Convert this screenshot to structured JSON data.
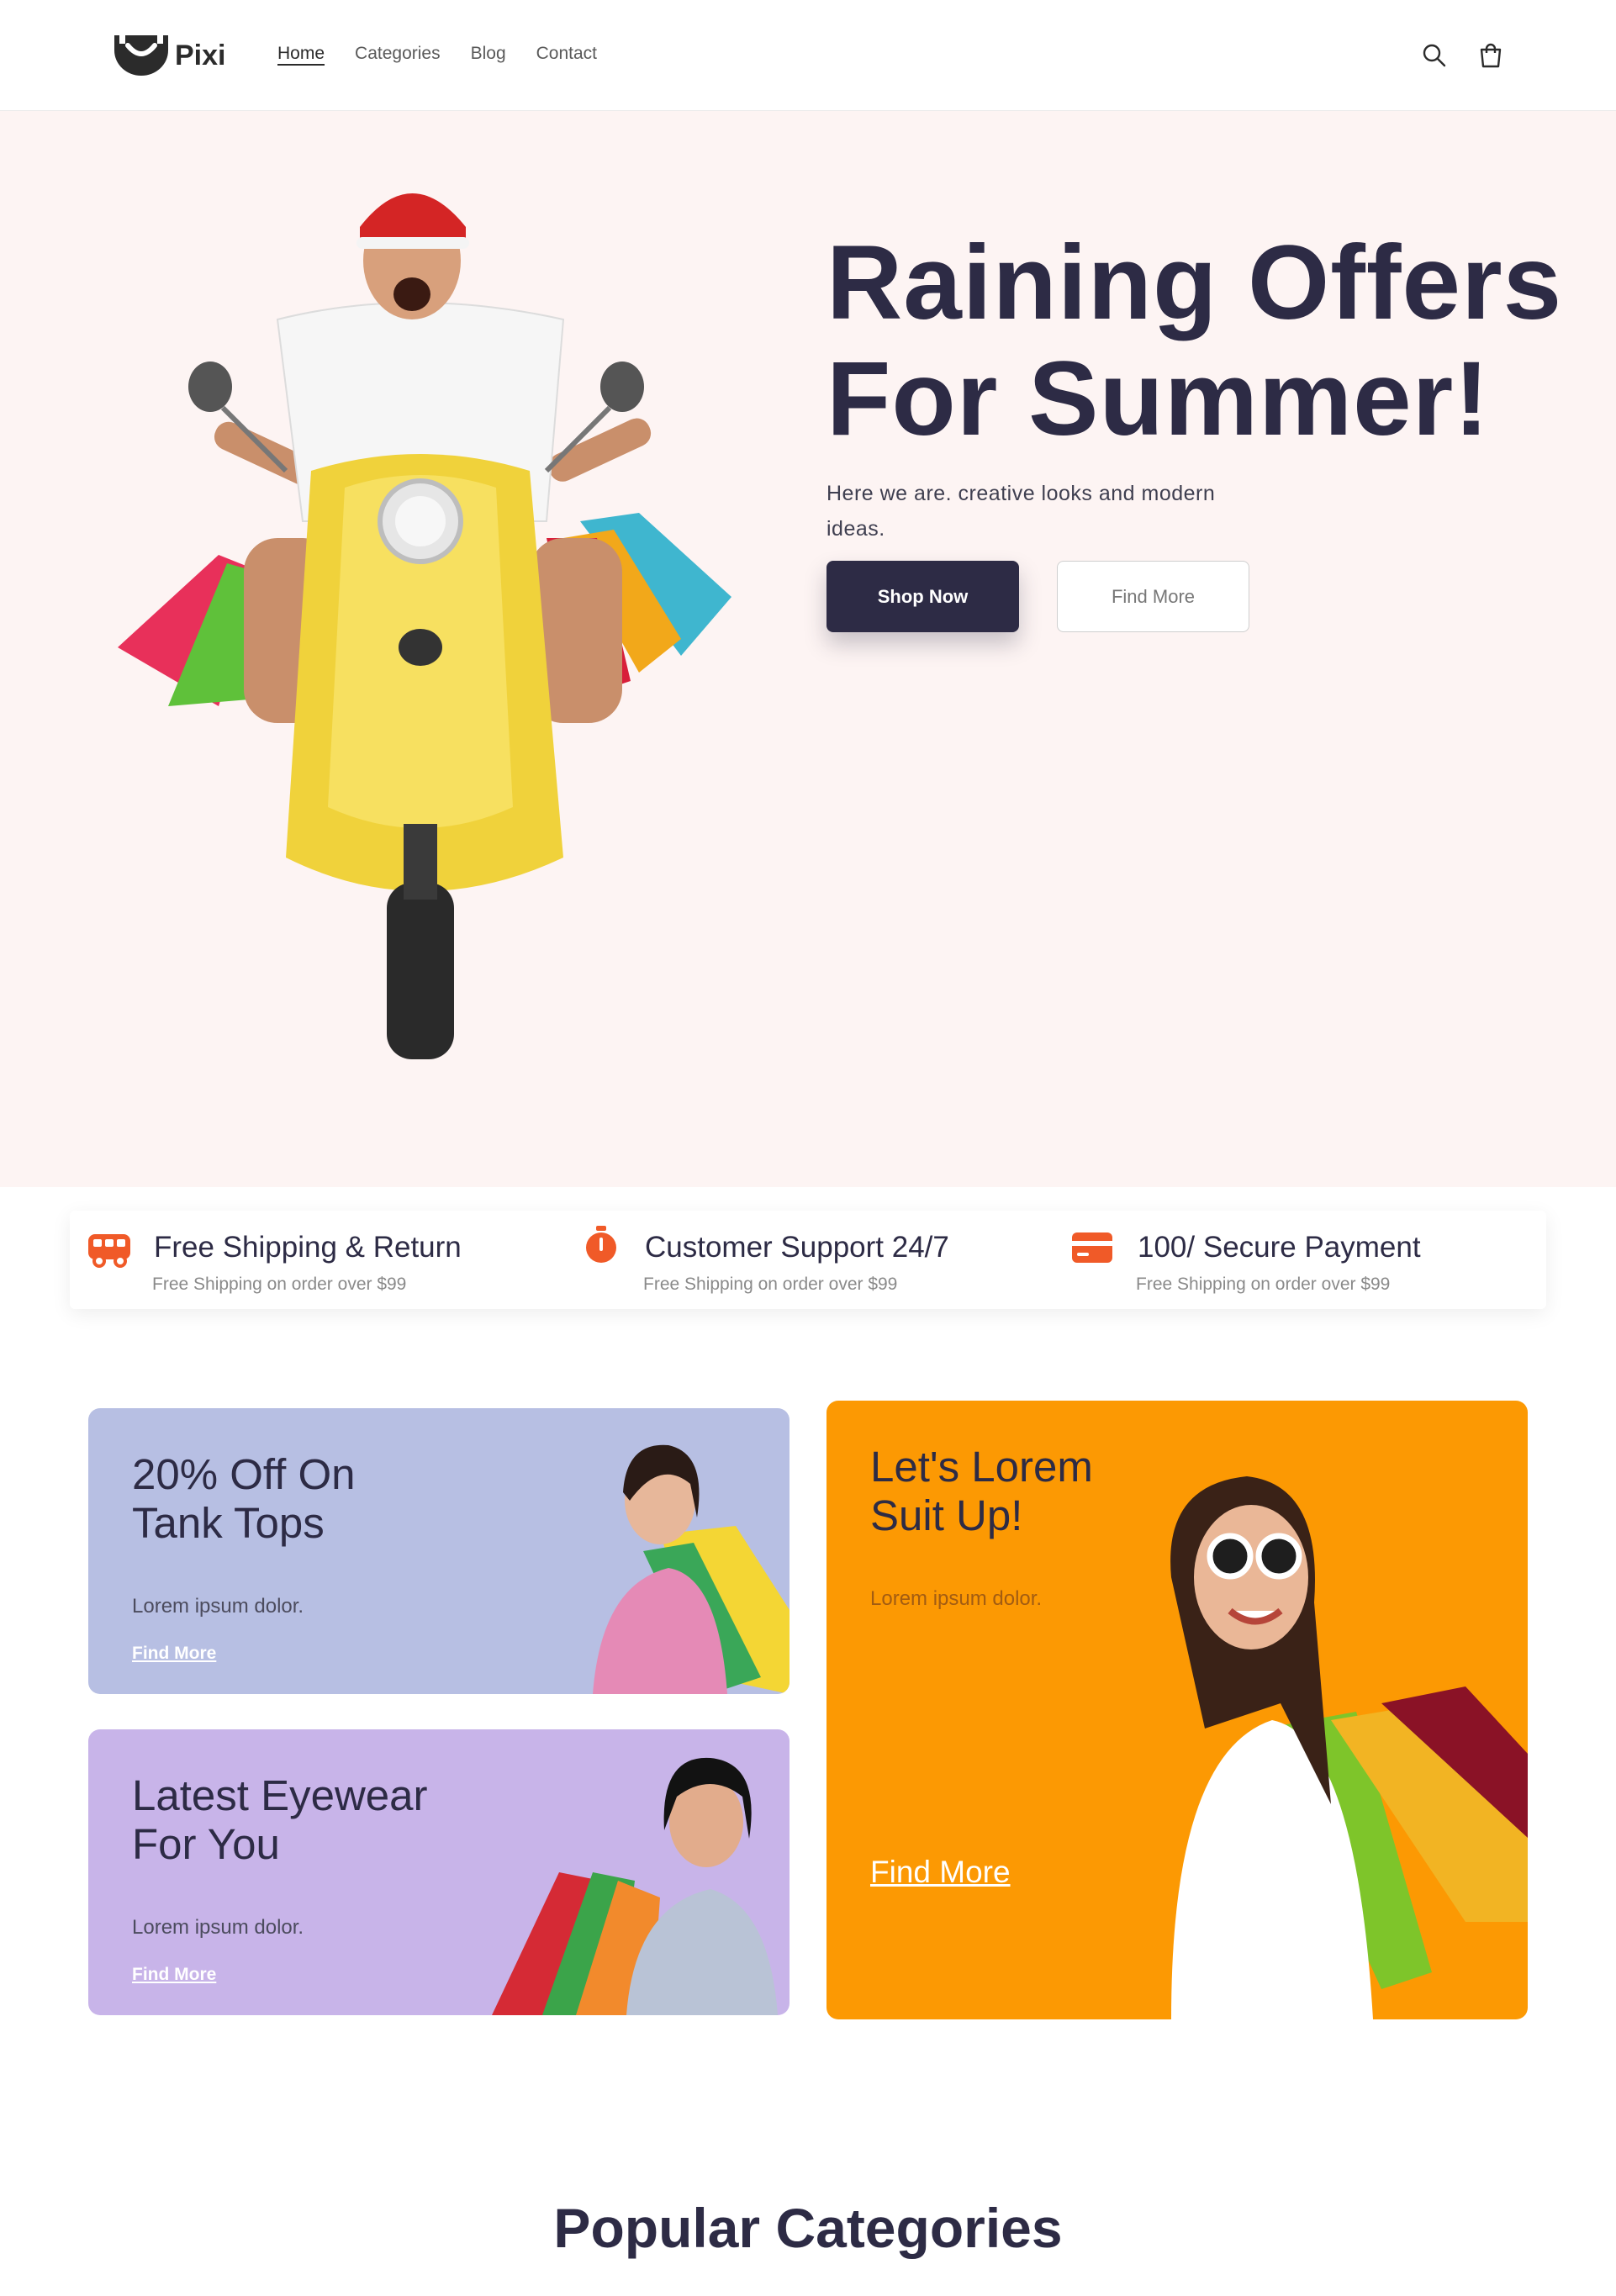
{
  "header": {
    "logo_text": "Pixi",
    "nav": [
      "Home",
      "Categories",
      "Blog",
      "Contact"
    ],
    "icons": [
      "search-icon",
      "cart-icon"
    ]
  },
  "hero": {
    "title_line1": "Raining Offers",
    "title_line2": "For Summer!",
    "subtitle": "Here we are. creative looks and modern ideas.",
    "primary_button": "Shop Now",
    "secondary_button": "Find More"
  },
  "features": [
    {
      "icon": "truck-icon",
      "title": "Free Shipping & Return",
      "subtitle": "Free Shipping on order over $99"
    },
    {
      "icon": "stopwatch-icon",
      "title": "Customer Support 24/7",
      "subtitle": "Free Shipping on order over $99"
    },
    {
      "icon": "credit-card-icon",
      "title": "100/ Secure Payment",
      "subtitle": "Free Shipping on order over $99"
    }
  ],
  "promos": {
    "tank_tops": {
      "title_line1": "20% Off On",
      "title_line2": "Tank Tops",
      "subtitle": "Lorem ipsum dolor.",
      "link": "Find More"
    },
    "eyewear": {
      "title_line1": "Latest Eyewear",
      "title_line2": "For You",
      "subtitle": "Lorem ipsum dolor.",
      "link": "Find More"
    },
    "suit_up": {
      "title_line1": "Let's Lorem",
      "title_line2": "Suit Up!",
      "subtitle": "Lorem ipsum dolor.",
      "link": "Find More"
    }
  },
  "popular_heading": "Popular Categories",
  "colors": {
    "brand_dark": "#2d2b45",
    "hero_bg": "#fdf4f3",
    "accent_orange": "#f05a28",
    "card_blue": "#b7bfe3",
    "card_purple": "#c8b4e9",
    "card_orange": "#fc9903"
  }
}
